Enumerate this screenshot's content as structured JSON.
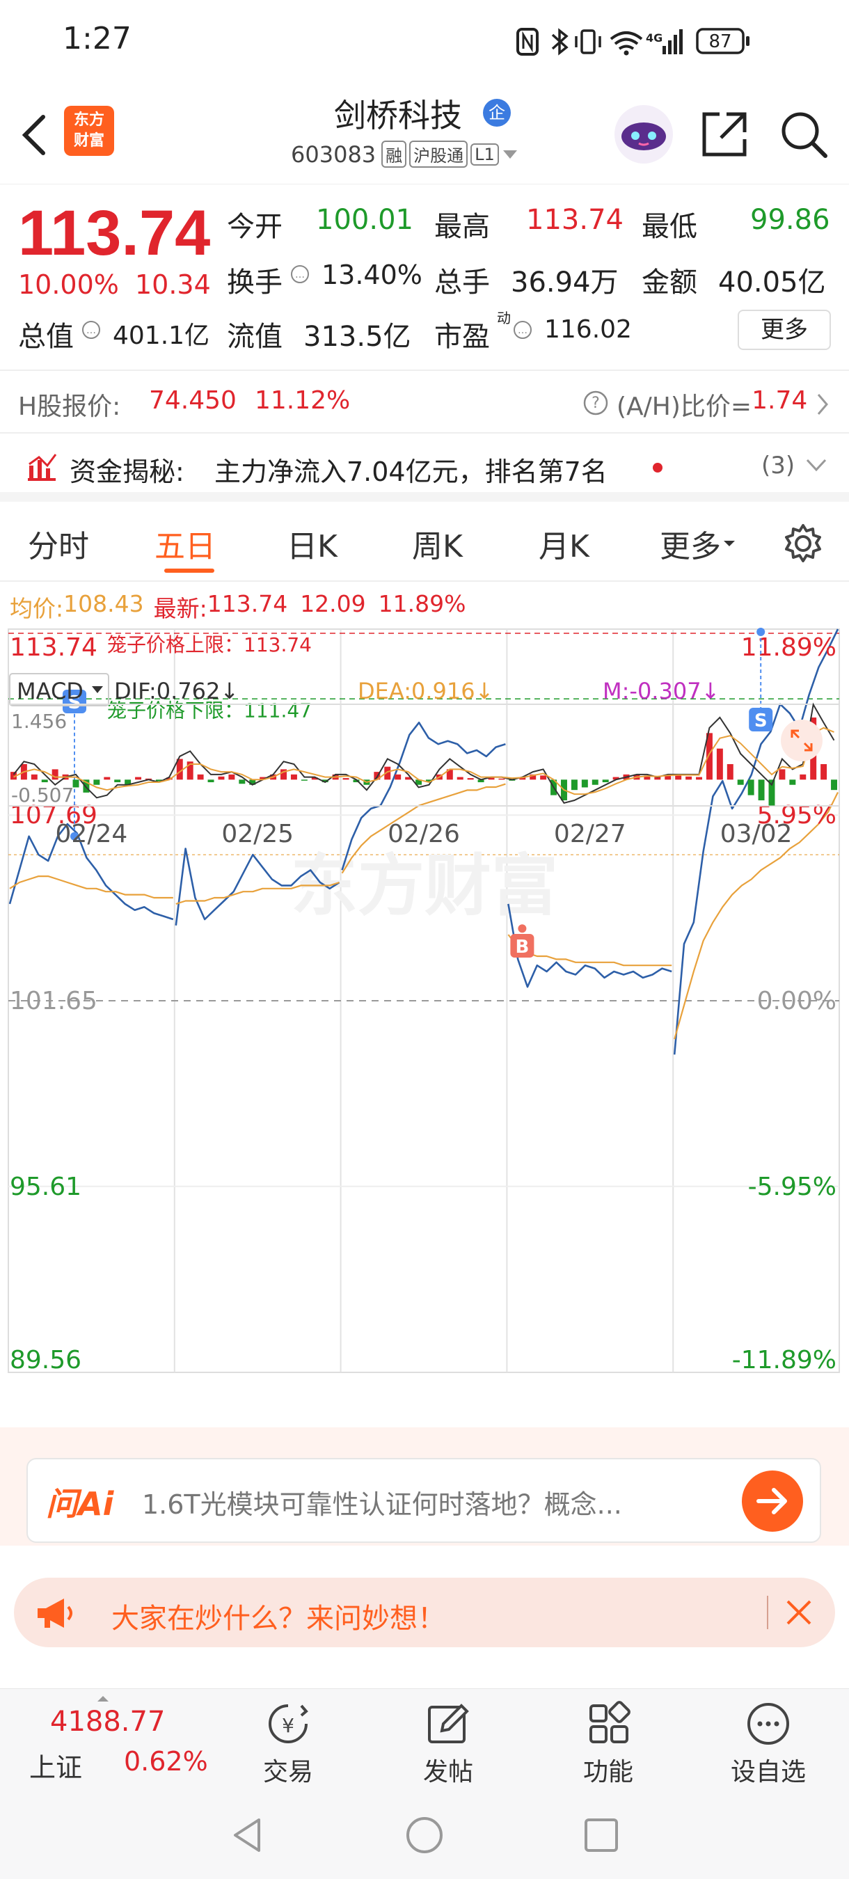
{
  "status": {
    "time": "1:27",
    "battery": "87",
    "network": "4G"
  },
  "header": {
    "logo_line1": "东方",
    "logo_line2": "财富",
    "name": "剑桥科技",
    "badge": "企",
    "code": "603083",
    "tags": [
      "融",
      "沪股通",
      "L1"
    ]
  },
  "quote": {
    "price": "113.74",
    "change_pct": "10.00%",
    "change": "10.34",
    "open_label": "今开",
    "open": "100.01",
    "high_label": "最高",
    "high": "113.74",
    "low_label": "最低",
    "low": "99.86",
    "turnover_label": "换手",
    "turnover": "13.40%",
    "volume_label": "总手",
    "volume": "36.94万",
    "amount_label": "金额",
    "amount": "40.05亿",
    "mktcap_label": "总值",
    "mktcap": "401.1亿",
    "float_label": "流值",
    "float": "313.5亿",
    "pe_label": "市盈",
    "pe_sup": "动",
    "pe": "116.02",
    "more_button": "更多"
  },
  "hshare": {
    "label": "H股报价:",
    "price": "74.450",
    "pct": "11.12%",
    "ratio_label": "(A/H)比价=",
    "ratio": "1.74"
  },
  "fund": {
    "title": "资金揭秘:",
    "text": "主力净流入7.04亿元，排名第7名",
    "count": "(3)"
  },
  "tabs": [
    {
      "label": "分时"
    },
    {
      "label": "五日"
    },
    {
      "label": "日K"
    },
    {
      "label": "周K"
    },
    {
      "label": "月K"
    },
    {
      "label": "更多"
    }
  ],
  "chart_info": {
    "avg_label": "均价:",
    "avg": "108.43",
    "latest_label": "最新:",
    "latest": "113.74",
    "chg": "12.09",
    "pct": "11.89%"
  },
  "chart_labels": {
    "upper_limit": "笼子价格上限：113.74",
    "lower_limit": "笼子价格下限：111.47",
    "watermark": "东方财富",
    "sell_marker": "S",
    "buy_marker": "B"
  },
  "chart_data": {
    "type": "line",
    "x": [
      "02/24",
      "02/25",
      "02/26",
      "02/27",
      "03/02"
    ],
    "y_left_ticks": [
      "113.74",
      "107.69",
      "101.65",
      "95.61",
      "89.56"
    ],
    "y_right_ticks": [
      "11.89%",
      "5.95%",
      "0.00%",
      "-5.95%",
      "-11.89%"
    ],
    "prev_close": 101.65,
    "ylim": [
      89.56,
      113.74
    ],
    "series": [
      {
        "name": "",
        "color": "#2d5fa8",
        "values_by_day": [
          [
            104.8,
            105.9,
            107.0,
            106.4,
            106.2,
            107.0,
            107.4,
            107.1,
            106.3,
            105.9,
            105.4,
            105.1,
            104.8,
            104.6,
            104.7,
            104.5,
            104.4,
            104.3
          ],
          [
            104.1,
            106.6,
            105.0,
            104.3,
            104.6,
            104.9,
            105.2,
            105.8,
            106.4,
            106.0,
            105.6,
            105.4,
            105.4,
            105.7,
            105.9,
            105.5,
            105.3,
            105.5
          ],
          [
            105.9,
            106.9,
            107.6,
            107.9,
            108.0,
            108.6,
            109.4,
            110.3,
            110.7,
            110.2,
            110.0,
            110.1,
            110.0,
            109.7,
            109.8,
            109.6,
            109.9,
            110.0
          ],
          [
            104.8,
            103.0,
            102.1,
            102.8,
            102.6,
            102.9,
            102.6,
            102.5,
            102.8,
            102.7,
            102.4,
            102.6,
            102.5,
            102.6,
            102.4,
            102.5,
            102.7,
            102.6
          ],
          [
            99.9,
            103.5,
            104.2,
            106.5,
            108.3,
            108.8,
            107.9,
            108.4,
            109.0,
            110.0,
            110.4,
            111.3,
            111.0,
            110.5,
            111.6,
            112.5,
            113.1,
            113.74
          ]
        ]
      },
      {
        "name": "",
        "color": "#e8a13b",
        "values_by_day": [
          [
            105.3,
            105.5,
            105.6,
            105.7,
            105.7,
            105.6,
            105.5,
            105.4,
            105.3,
            105.3,
            105.2,
            105.2,
            105.1,
            105.1,
            105.1,
            105.0,
            105.0,
            105.0
          ],
          [
            104.8,
            104.9,
            104.9,
            104.9,
            105.0,
            105.0,
            105.1,
            105.2,
            105.2,
            105.3,
            105.3,
            105.3,
            105.3,
            105.4,
            105.4,
            105.4,
            105.4,
            105.5
          ],
          [
            105.8,
            106.3,
            106.7,
            107.0,
            107.2,
            107.4,
            107.6,
            107.8,
            108.0,
            108.1,
            108.2,
            108.3,
            108.4,
            108.5,
            108.5,
            108.6,
            108.6,
            108.7
          ],
          [
            103.8,
            103.4,
            103.2,
            103.1,
            103.1,
            103.0,
            103.0,
            102.9,
            102.9,
            102.9,
            102.9,
            102.9,
            102.8,
            102.8,
            102.8,
            102.8,
            102.8,
            102.8
          ],
          [
            100.4,
            101.5,
            102.6,
            103.6,
            104.2,
            104.7,
            105.1,
            105.4,
            105.6,
            105.9,
            106.1,
            106.3,
            106.6,
            106.8,
            107.1,
            107.4,
            107.8,
            108.43
          ]
        ]
      }
    ]
  },
  "macd": {
    "label": "MACD",
    "dif": "DIF:0.762",
    "dea": "DEA:0.916",
    "m": "M:-0.307",
    "top": "1.456",
    "bottom": "-0.507",
    "ylim": [
      -0.507,
      1.456
    ],
    "hist": [
      0.15,
      0.3,
      0.1,
      -0.05,
      0.2,
      0.1,
      -0.15,
      -0.25,
      -0.1,
      0.05,
      -0.05,
      -0.1,
      0.05,
      0.02,
      -0.03,
      0.04,
      0.4,
      0.35,
      0.1,
      -0.05,
      0.06,
      0.1,
      -0.08,
      -0.1,
      0.05,
      0.1,
      0.2,
      0.1,
      -0.02,
      0.04,
      -0.05,
      0.1,
      0.03,
      -0.05,
      -0.1,
      0.15,
      0.25,
      0.1,
      0.05,
      -0.1,
      -0.05,
      0.1,
      0.2,
      0.05,
      0.03,
      -0.05,
      0.04,
      0.02,
      -0.02,
      0.05,
      0.1,
      0.08,
      -0.3,
      -0.4,
      -0.2,
      -0.15,
      -0.1,
      -0.05,
      0.05,
      0.1,
      0.1,
      0.08,
      0.05,
      0.07,
      0.1,
      0.06,
      0.05,
      0.9,
      0.6,
      0.3,
      -0.1,
      -0.3,
      -0.4,
      -0.5,
      0.2,
      -0.1,
      0.1,
      1.2,
      0.3,
      -0.2
    ],
    "dif_values": [
      0.1,
      0.35,
      0.3,
      0.1,
      -0.1,
      0.05,
      0.1,
      -0.15,
      -0.35,
      -0.3,
      -0.1,
      -0.1,
      -0.05,
      0.0,
      -0.05,
      0.05,
      0.45,
      0.55,
      0.3,
      0.1,
      0.1,
      0.15,
      0.05,
      -0.1,
      0.0,
      0.1,
      0.35,
      0.3,
      0.05,
      0.05,
      -0.05,
      0.1,
      0.1,
      0.0,
      -0.2,
      0.05,
      0.4,
      0.3,
      0.1,
      -0.15,
      -0.1,
      0.2,
      0.4,
      0.25,
      0.1,
      0.0,
      0.05,
      0.05,
      0.0,
      0.05,
      0.15,
      0.2,
      -0.15,
      -0.45,
      -0.4,
      -0.3,
      -0.2,
      -0.1,
      0.0,
      0.05,
      0.1,
      0.1,
      0.05,
      0.1,
      0.1,
      0.1,
      0.1,
      1.0,
      1.2,
      0.9,
      0.5,
      0.3,
      0.1,
      -0.1,
      0.4,
      0.2,
      0.3,
      1.45,
      1.1,
      0.76
    ],
    "dea_values": [
      0.05,
      0.15,
      0.2,
      0.15,
      0.05,
      0.05,
      0.05,
      -0.05,
      -0.15,
      -0.2,
      -0.15,
      -0.12,
      -0.1,
      -0.05,
      -0.05,
      0.0,
      0.15,
      0.3,
      0.3,
      0.2,
      0.15,
      0.15,
      0.1,
      0.0,
      0.0,
      0.05,
      0.15,
      0.2,
      0.15,
      0.1,
      0.05,
      0.05,
      0.07,
      0.05,
      -0.05,
      0.0,
      0.15,
      0.2,
      0.15,
      0.0,
      -0.05,
      0.05,
      0.2,
      0.2,
      0.15,
      0.05,
      0.05,
      0.05,
      0.03,
      0.04,
      0.08,
      0.12,
      0.0,
      -0.2,
      -0.28,
      -0.28,
      -0.24,
      -0.17,
      -0.08,
      0.0,
      0.05,
      0.07,
      0.06,
      0.08,
      0.09,
      0.09,
      0.09,
      0.5,
      0.8,
      0.85,
      0.7,
      0.5,
      0.3,
      0.1,
      0.25,
      0.22,
      0.26,
      0.9,
      1.0,
      0.92
    ],
    "dif_color": "#333333",
    "dea_color": "#e8a13b",
    "up_color": "#e0252d",
    "down_color": "#1e9a2a"
  },
  "ai": {
    "logo": "问Ai",
    "text": "1.6T光模块可靠性认证何时落地？概念..."
  },
  "hot": {
    "text": "大家在炒什么？来问妙想！"
  },
  "bottom": {
    "index_value": "4188.77",
    "index_name": "上证",
    "index_pct": "0.62%",
    "items": [
      {
        "label": "交易"
      },
      {
        "label": "发帖"
      },
      {
        "label": "功能"
      },
      {
        "label": "设自选"
      }
    ]
  },
  "colors": {
    "accent": "#ff5f1f",
    "up": "#e0252d",
    "down": "#1e9a2a",
    "price_line": "#2d5fa8",
    "avg_line": "#e8a13b"
  }
}
